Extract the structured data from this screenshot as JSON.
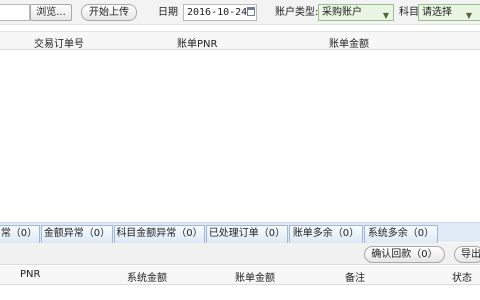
{
  "toolbar": {
    "browse_label": "浏览...",
    "upload_label": "开始上传",
    "date_label": "日期",
    "date_value": "2016-10-24",
    "account_type_label": "账户类型:",
    "account_type_value": "采购账户",
    "subject_label": "科目",
    "subject_value": "请选择"
  },
  "upper_table": {
    "columns": [
      "交易订单号",
      "账单PNR",
      "账单金额"
    ]
  },
  "tabs": [
    {
      "label": "常（0）"
    },
    {
      "label": "金额异常（0）"
    },
    {
      "label": "科目金额异常（0）"
    },
    {
      "label": "已处理订单（0）"
    },
    {
      "label": "账单多余（0）"
    },
    {
      "label": "系统多余（0）"
    }
  ],
  "actions": {
    "confirm_label": "确认回款（0）",
    "export_label": "导出"
  },
  "lower_table": {
    "columns": [
      "PNR",
      "系统金额",
      "账单金额",
      "备注",
      "状态"
    ]
  },
  "colors": {
    "select_bg": "#eaf5e3",
    "tab_bg": "#dfeaf4",
    "tab_border": "#9fb9d3"
  },
  "icons": {
    "date_picker": "calendar-icon",
    "dropdown": "chevron-down-icon"
  }
}
